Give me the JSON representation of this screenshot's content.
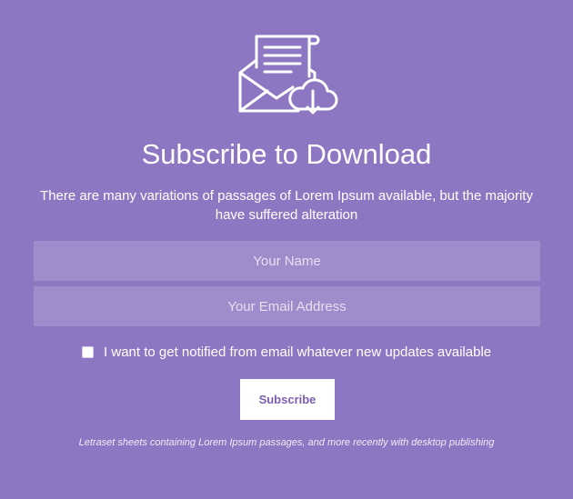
{
  "hero": {
    "icon": "envelope-letter-cloud-download-icon"
  },
  "title": "Subscribe to Download",
  "description": "There are many variations of passages of Lorem Ipsum available, but the majority have suffered alteration",
  "form": {
    "name_placeholder": "Your Name",
    "email_placeholder": "Your Email Address",
    "checkbox_label": "I want to get notified from email whatever new updates available",
    "checkbox_checked": false,
    "submit_label": "Subscribe"
  },
  "footnote": "Letraset sheets containing Lorem Ipsum passages, and more recently with desktop publishing",
  "colors": {
    "background": "#8e77c2",
    "button_text": "#7a5fb4",
    "text": "#ffffff"
  }
}
